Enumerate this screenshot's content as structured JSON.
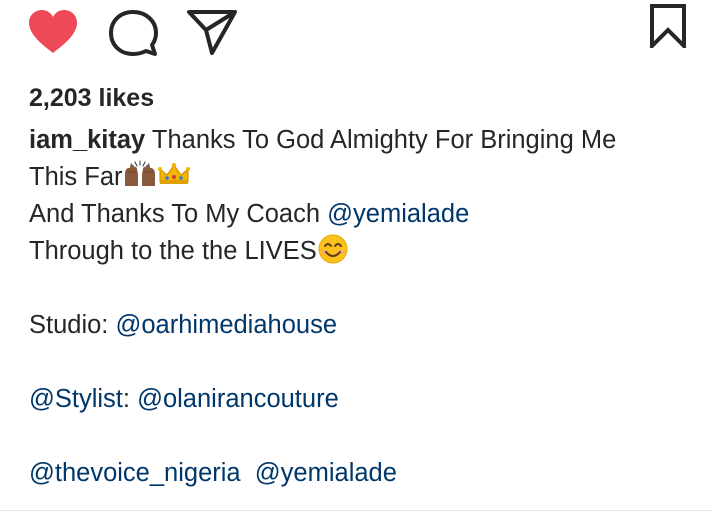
{
  "post": {
    "likes_text": "2,203 likes",
    "actions": {
      "like": "heart-icon",
      "comment": "comment-icon",
      "share": "paper-plane-icon",
      "save": "bookmark-icon"
    },
    "caption": {
      "username": "iam_kitay",
      "line1_text": " Thanks To God Almighty For Bringing Me",
      "line2_text": "This Far",
      "line3_text": "And Thanks To My Coach ",
      "line3_mention": "@yemialade",
      "line4_text": "Through to the the LIVES",
      "line6_text": "Studio: ",
      "line6_mention": "@oarhimediahouse",
      "line8_mention1": "@Stylist",
      "line8_text": ": ",
      "line8_mention2": "@olanirancouture",
      "line10_mention1": "@thevoice_nigeria",
      "line10_text": "  ",
      "line10_mention2": "@yemialade"
    }
  },
  "colors": {
    "heart": "#ed4956",
    "text": "#262626",
    "mention": "#00376b",
    "icon": "#262626"
  }
}
